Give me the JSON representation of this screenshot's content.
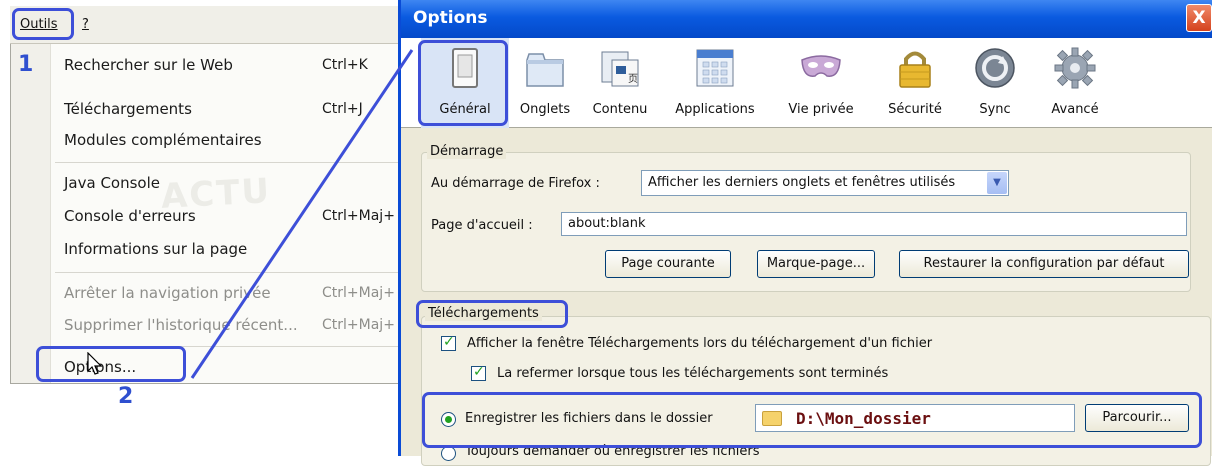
{
  "menubar": {
    "outils": "Outils",
    "help": "?"
  },
  "menu": {
    "items": [
      {
        "label": "Rechercher sur le Web",
        "shortcut": "Ctrl+K",
        "disabled": false
      },
      {
        "label": "Téléchargements",
        "shortcut": "Ctrl+J",
        "disabled": false
      },
      {
        "label": "Modules complémentaires",
        "shortcut": "",
        "disabled": false
      },
      {
        "label": "Java Console",
        "shortcut": "",
        "disabled": false
      },
      {
        "label": "Console d'erreurs",
        "shortcut": "Ctrl+Maj+",
        "disabled": false
      },
      {
        "label": "Informations sur la page",
        "shortcut": "",
        "disabled": false
      },
      {
        "label": "Arrêter la navigation privée",
        "shortcut": "Ctrl+Maj+",
        "disabled": true
      },
      {
        "label": "Supprimer l'historique récent...",
        "shortcut": "Ctrl+Maj+",
        "disabled": true
      },
      {
        "label": "Options...",
        "shortcut": "",
        "disabled": false
      }
    ]
  },
  "steps": {
    "one": "1",
    "two": "2"
  },
  "dialog": {
    "title": "Options",
    "close": "X",
    "tabs": [
      {
        "label": "Général",
        "icon": "switch-icon"
      },
      {
        "label": "Onglets",
        "icon": "tabs-icon"
      },
      {
        "label": "Contenu",
        "icon": "content-icon"
      },
      {
        "label": "Applications",
        "icon": "applications-icon"
      },
      {
        "label": "Vie privée",
        "icon": "mask-icon"
      },
      {
        "label": "Sécurité",
        "icon": "padlock-icon"
      },
      {
        "label": "Sync",
        "icon": "sync-icon"
      },
      {
        "label": "Avancé",
        "icon": "gear-icon"
      }
    ],
    "startup": {
      "legend": "Démarrage",
      "startup_label": "Au démarrage de Firefox :",
      "startup_value": "Afficher les derniers onglets et fenêtres utilisés",
      "homepage_label": "Page d'accueil :",
      "homepage_value": "about:blank",
      "btn_current": "Page courante",
      "btn_bookmark": "Marque-page...",
      "btn_restore": "Restaurer la configuration par défaut"
    },
    "downloads": {
      "legend": "Téléchargements",
      "show_window": "Afficher la fenêtre Téléchargements lors du téléchargement d'un fichier",
      "close_when_done": "La refermer lorsque tous les téléchargements sont terminés",
      "save_to": "Enregistrer les fichiers dans le dossier",
      "folder": "D:\\Mon_dossier",
      "browse": "Parcourir...",
      "always_ask": "Toujours demander où enregistrer les fichiers"
    }
  },
  "colors": {
    "highlight": "#3d4fd8",
    "titlebar": "#0a5ae0",
    "check": "#21a121"
  }
}
